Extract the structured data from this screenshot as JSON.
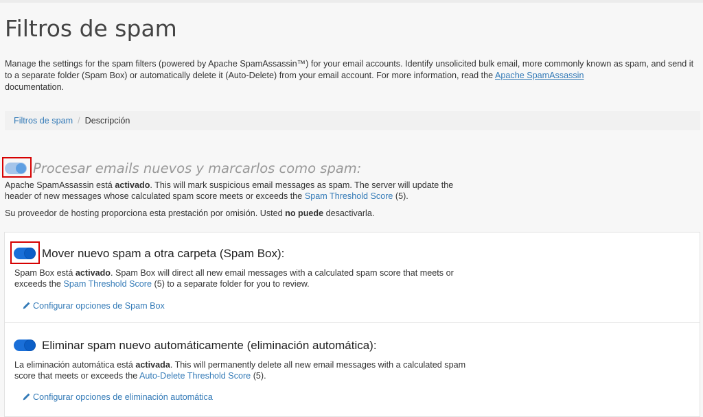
{
  "page": {
    "title": "Filtros de spam",
    "description_1": "Manage the settings for the spam filters (powered by Apache SpamAssassin™) for your email accounts. Identify unsolicited bulk email, more commonly known as spam, and send it to a separate folder (Spam Box) or automatically delete it (Auto-Delete) from your email account. For more information, read the ",
    "description_link": "Apache SpamAssassin",
    "description_2": "documentation."
  },
  "breadcrumb": {
    "root": "Filtros de spam",
    "separator": "/",
    "current": "Descripción"
  },
  "process": {
    "heading": "Procesar emails nuevos y marcarlos como spam:",
    "text_1": "Apache SpamAssassin está ",
    "text_bold": "activado",
    "text_2": ". This will mark suspicious email messages as spam. The server will update the header of new messages whose calculated spam score meets or exceeds the ",
    "text_link": "Spam Threshold Score",
    "text_3": " (5).",
    "note_1": "Su proveedor de hosting proporciona esta prestación por omisión. Usted ",
    "note_bold": "no puede",
    "note_2": " desactivarla."
  },
  "spambox": {
    "heading": "Mover nuevo spam a otra carpeta (Spam Box):",
    "text_1": "Spam Box está ",
    "text_bold": "activado",
    "text_2": ". Spam Box will direct all new email messages with a calculated spam score that meets or exceeds the ",
    "text_link": "Spam Threshold Score",
    "text_3": " (5) to a separate folder for you to review.",
    "configure": "Configurar opciones de Spam Box"
  },
  "autodelete": {
    "heading": "Eliminar spam nuevo automáticamente (eliminación automática):",
    "text_1": "La eliminación automática está ",
    "text_bold": "activada",
    "text_2": ". This will permanently delete all new email messages with a calculated spam score that meets or exceeds the ",
    "text_link": "Auto-Delete Threshold Score",
    "text_3": " (5).",
    "configure": "Configurar opciones de eliminación automática"
  },
  "colors": {
    "link": "#337ab7",
    "toggle_on": "#1a6fd8",
    "toggle_disabled": "#a5c5ea",
    "highlight": "#d60000"
  }
}
